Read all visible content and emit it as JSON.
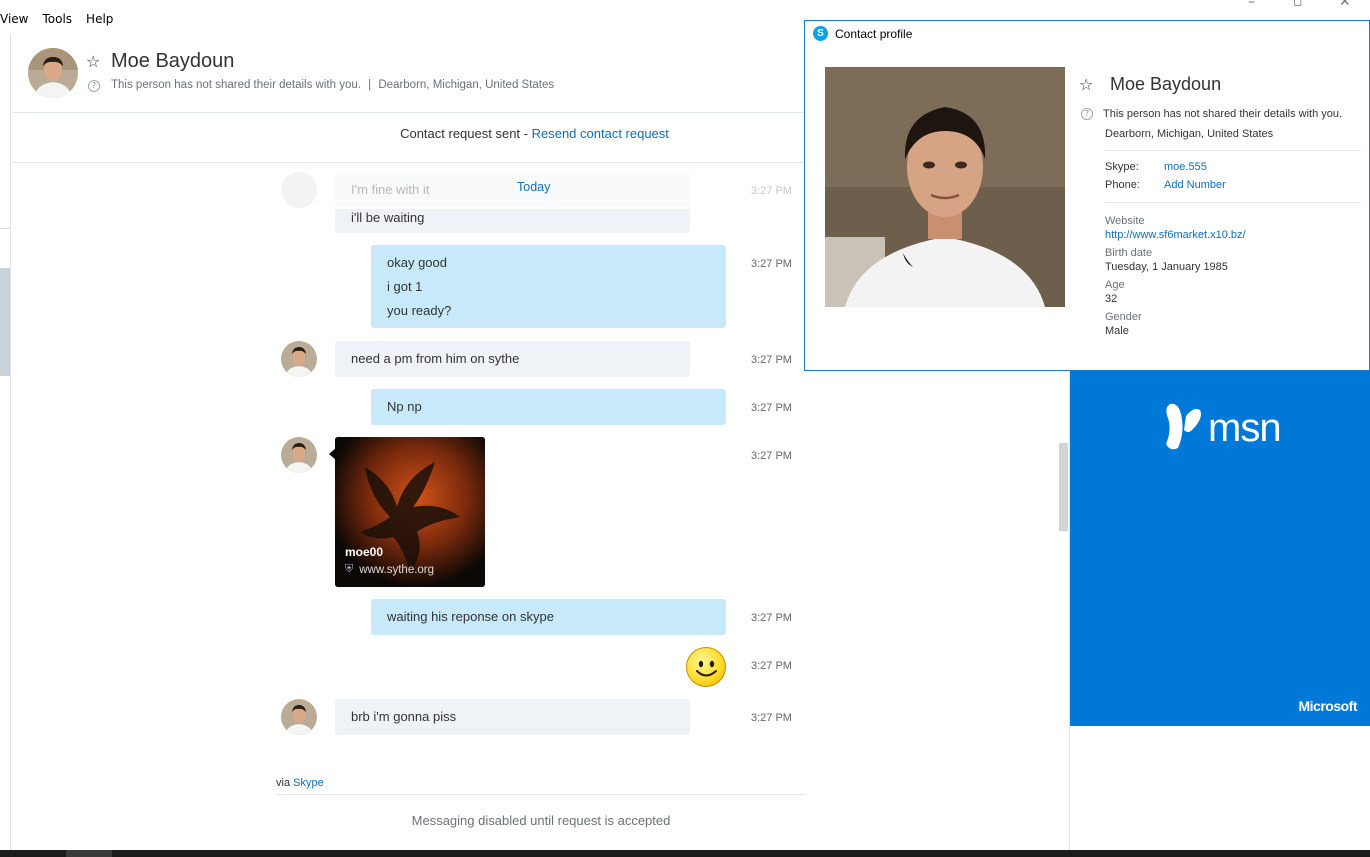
{
  "menu": {
    "items": [
      "View",
      "Tools",
      "Help"
    ]
  },
  "header": {
    "name": "Moe Baydoun",
    "privacy_note": "This person has not shared their details with you.",
    "separator": "|",
    "location": "Dearborn, Michigan, United States"
  },
  "request_bar": {
    "text": "Contact request sent - ",
    "link": "Resend contact request"
  },
  "chat": {
    "day_label": "Today",
    "ghost_message": "I'm fine with it",
    "ghost_time": "3:27 PM",
    "messages": [
      {
        "from": "them",
        "lines": [
          "i'll be waiting"
        ],
        "time": ""
      },
      {
        "from": "me",
        "lines": [
          "okay good",
          "i got 1",
          "you ready?"
        ],
        "time": "3:27 PM"
      },
      {
        "from": "them",
        "lines": [
          "need a pm from him on sythe"
        ],
        "time": "3:27 PM"
      },
      {
        "from": "me",
        "lines": [
          "Np np"
        ],
        "time": "3:27 PM"
      },
      {
        "from": "them",
        "card": {
          "title": "moe00",
          "url": "www.sythe.org"
        },
        "time": "3:27 PM"
      },
      {
        "from": "me",
        "lines": [
          "waiting his reponse on skype"
        ],
        "time": "3:27 PM"
      },
      {
        "from": "me",
        "emoticon": "smile-emoticon",
        "time": "3:27 PM"
      },
      {
        "from": "them",
        "lines": [
          "brb i'm gonna piss"
        ],
        "time": "3:27 PM"
      }
    ],
    "via_prefix": "via ",
    "via_link": "Skype",
    "disabled_notice": "Messaging disabled until request is accepted"
  },
  "ad": {
    "brand": "msn",
    "footer": "Microsoft",
    "background": "#0078d7"
  },
  "profile_popup": {
    "window_title": "Contact profile",
    "name": "Moe Baydoun",
    "privacy_note": "This person has not shared their details with you.",
    "location": "Dearborn, Michigan, United States",
    "skype_label": "Skype:",
    "skype_value": "moe.555",
    "phone_label": "Phone:",
    "phone_value": "Add Number",
    "website_label": "Website",
    "website_value": "http://www.sf6market.x10.bz/",
    "birth_label": "Birth date",
    "birth_value": "Tuesday, 1 January 1985",
    "age_label": "Age",
    "age_value": "32",
    "gender_label": "Gender",
    "gender_value": "Male"
  },
  "colors": {
    "accent": "#0f6eb5",
    "bubble_me": "#c7e9f9",
    "bubble_them": "#eff2f6"
  }
}
